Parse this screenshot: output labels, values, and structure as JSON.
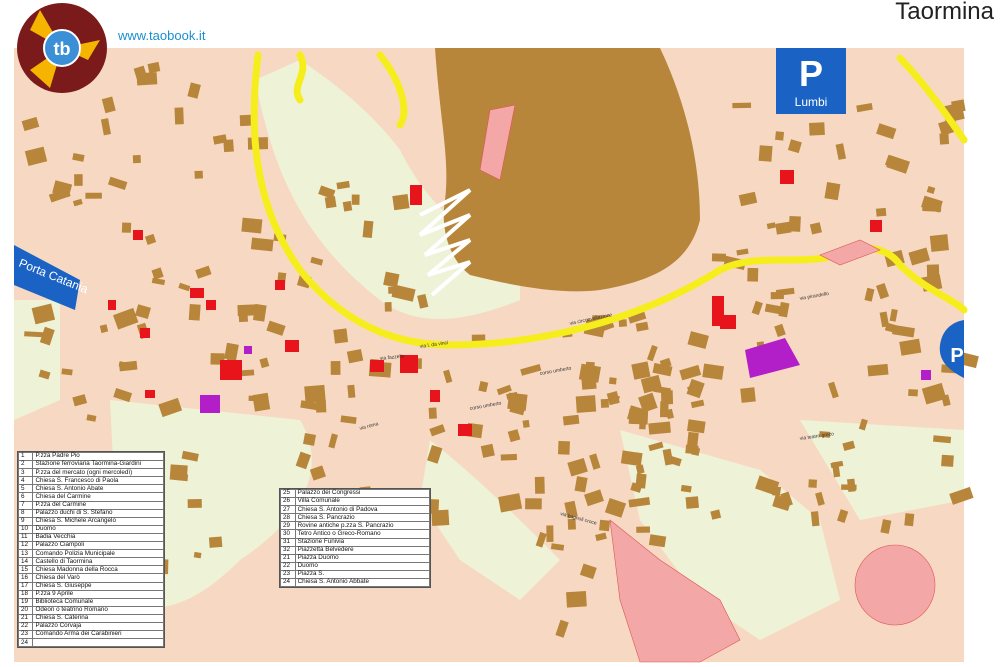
{
  "brand": {
    "logo_text": "tb",
    "url": "www.taobook.it"
  },
  "title": "Taormina",
  "parking": [
    {
      "letter": "P",
      "label": "Lumbi"
    },
    {
      "letter": "P",
      "label": ""
    }
  ],
  "gate_label": "Porta Catania",
  "street_labels": [
    "via l. da vinci",
    "via circonvallazione",
    "corso umberto",
    "via fazzello",
    "via roma",
    "via pirandello",
    "corso umberto",
    "via teatro greco",
    "via bagnoli croce"
  ],
  "colors": {
    "built": "#b8863b",
    "ground": "#f7d9c3",
    "green": "#eef3d8",
    "road": "#f5ee1c",
    "landmark": "#e8141c",
    "church": "#b21fc9",
    "archaeology": "#f4a7a7",
    "parking": "#1a63c4"
  },
  "legend_left": [
    {
      "n": "1",
      "text": "P.zza Padre Pio"
    },
    {
      "n": "2",
      "text": "Stazione ferroviaria Taormina-Giardini"
    },
    {
      "n": "3",
      "text": "P.zza del mercato (ogni mercoledì)"
    },
    {
      "n": "4",
      "text": "Chiesa S. Francesco di Paola"
    },
    {
      "n": "5",
      "text": "Chiesa S. Antonio Abate"
    },
    {
      "n": "6",
      "text": "Chiesa del Carmine"
    },
    {
      "n": "7",
      "text": "P.zza del Carmine"
    },
    {
      "n": "8",
      "text": "Palazzo duchi di S. Stefano"
    },
    {
      "n": "9",
      "text": "Chiesa S. Michele Arcangelo"
    },
    {
      "n": "10",
      "text": "Duomo"
    },
    {
      "n": "11",
      "text": "Badia Vecchia"
    },
    {
      "n": "12",
      "text": "Palazzo Ciampoli"
    },
    {
      "n": "13",
      "text": "Comando Polizia Municipale"
    },
    {
      "n": "14",
      "text": "Castello di Taormina"
    },
    {
      "n": "15",
      "text": "Chiesa Madonna della Rocca"
    },
    {
      "n": "16",
      "text": "Chiesa del Varò"
    },
    {
      "n": "17",
      "text": "Chiesa S. Giuseppe"
    },
    {
      "n": "18",
      "text": "P.zza 9 Aprile"
    },
    {
      "n": "19",
      "text": "Biblioteca Comunale"
    },
    {
      "n": "20",
      "text": "Odeon o teatrino Romano"
    },
    {
      "n": "21",
      "text": "Chiesa S. Caterina"
    },
    {
      "n": "22",
      "text": "Palazzo Corvaja"
    },
    {
      "n": "23",
      "text": "Comando Arma dei Carabinieri"
    },
    {
      "n": "24",
      "text": ""
    }
  ],
  "legend_right": [
    {
      "n": "25",
      "text": "Palazzo dei Congressi"
    },
    {
      "n": "26",
      "text": "Villa Comunale"
    },
    {
      "n": "27",
      "text": "Chiesa S. Antonio di Padova"
    },
    {
      "n": "28",
      "text": "Chiesa S. Pancrazio"
    },
    {
      "n": "29",
      "text": "Rovine antiche p.zza S. Pancrazio"
    },
    {
      "n": "30",
      "text": "Tetro Antico o Greco-Romano"
    },
    {
      "n": "31",
      "text": "Stazione Funivia"
    },
    {
      "n": "32",
      "text": "Piazzetta Belvedere"
    },
    {
      "n": "21",
      "text": "Piazza Duomo"
    },
    {
      "n": "22",
      "text": "Duomo"
    },
    {
      "n": "23",
      "text": "Piazza S."
    },
    {
      "n": "24",
      "text": "Chiesa S. Antonio Abbate"
    }
  ]
}
